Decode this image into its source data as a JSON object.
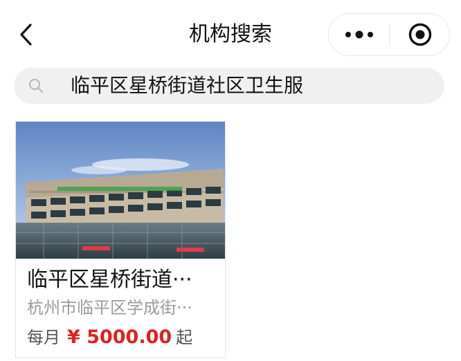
{
  "header": {
    "title": "机构搜索",
    "back_icon": "chevron-left-icon",
    "more_icon": "more-dots-icon",
    "close_icon": "target-circle-icon"
  },
  "search": {
    "value": "临平区星桥街道社区卫生服务中心",
    "icon": "search-icon"
  },
  "results": [
    {
      "name": "临平区星桥街道···",
      "address": "杭州市临平区学成街···",
      "price_prefix": "每月",
      "price": "¥ 5000.00",
      "price_suffix": "起"
    }
  ],
  "colors": {
    "price": "#e0211b",
    "search_bg": "#f0f0f0",
    "muted_text": "#9a9a9a"
  }
}
